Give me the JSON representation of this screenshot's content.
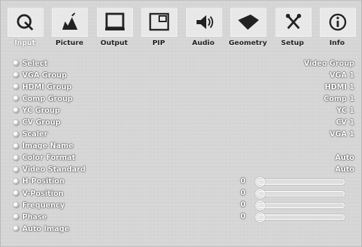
{
  "tabs": [
    {
      "label": "Input",
      "icon": "input-icon"
    },
    {
      "label": "Picture",
      "icon": "picture-icon"
    },
    {
      "label": "Output",
      "icon": "output-icon"
    },
    {
      "label": "PIP",
      "icon": "pip-icon"
    },
    {
      "label": "Audio",
      "icon": "audio-icon"
    },
    {
      "label": "Geometry",
      "icon": "geometry-icon"
    },
    {
      "label": "Setup",
      "icon": "setup-icon"
    },
    {
      "label": "Info",
      "icon": "info-icon"
    }
  ],
  "active_tab": "Input",
  "menu": [
    {
      "label": "Select",
      "value": "Video Group"
    },
    {
      "label": "VGA Group",
      "value": "VGA 1"
    },
    {
      "label": "HDMI Group",
      "value": "HDMI 1"
    },
    {
      "label": "Comp Group",
      "value": "Comp 1"
    },
    {
      "label": "YC Group",
      "value": "YC 1"
    },
    {
      "label": "CV Group",
      "value": "CV 1"
    },
    {
      "label": "Scaler",
      "value": "VGA 1"
    },
    {
      "label": "Image Name",
      "value": ""
    },
    {
      "label": "Color Format",
      "value": "Auto"
    },
    {
      "label": "Video Standard",
      "value": "Auto"
    },
    {
      "label": "H-Position",
      "number": "0"
    },
    {
      "label": "V-Position",
      "number": "0"
    },
    {
      "label": "Frequency",
      "number": "0"
    },
    {
      "label": "Phase",
      "number": "0"
    },
    {
      "label": "Auto Image",
      "value": ""
    }
  ]
}
